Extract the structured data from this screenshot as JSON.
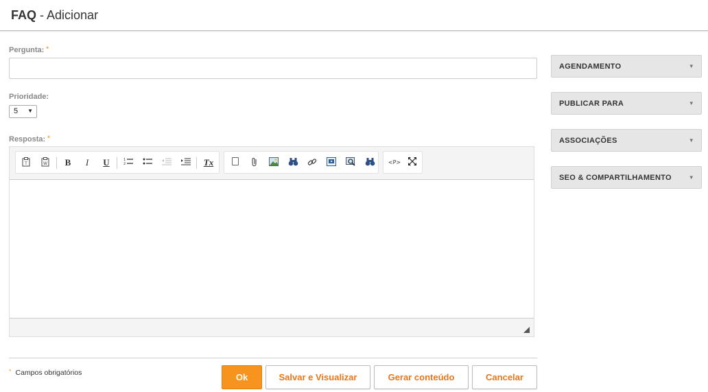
{
  "header": {
    "title_bold": "FAQ",
    "title_rest": " - Adicionar"
  },
  "form": {
    "pergunta_label": "Pergunta:",
    "prioridade_label": "Prioridade:",
    "prioridade_value": "5",
    "resposta_label": "Resposta:",
    "required_mark": "*"
  },
  "toolbar": {
    "bold": "B",
    "italic": "I",
    "underline": "U",
    "clear_format": "Tx",
    "source": "<P>"
  },
  "footer": {
    "required_note": "Campos obrigatórios",
    "ok_label": "Ok",
    "save_preview_label": "Salvar e Visualizar",
    "generate_label": "Gerar conteúdo",
    "cancel_label": "Cancelar"
  },
  "sidebar": {
    "panels": [
      {
        "label": "AGENDAMENTO"
      },
      {
        "label": "PUBLICAR PARA"
      },
      {
        "label": "ASSOCIAÇÕES"
      },
      {
        "label": "SEO & COMPARTILHAMENTO"
      }
    ]
  },
  "colors": {
    "accent": "#f7941d",
    "link_orange": "#e8761b"
  }
}
